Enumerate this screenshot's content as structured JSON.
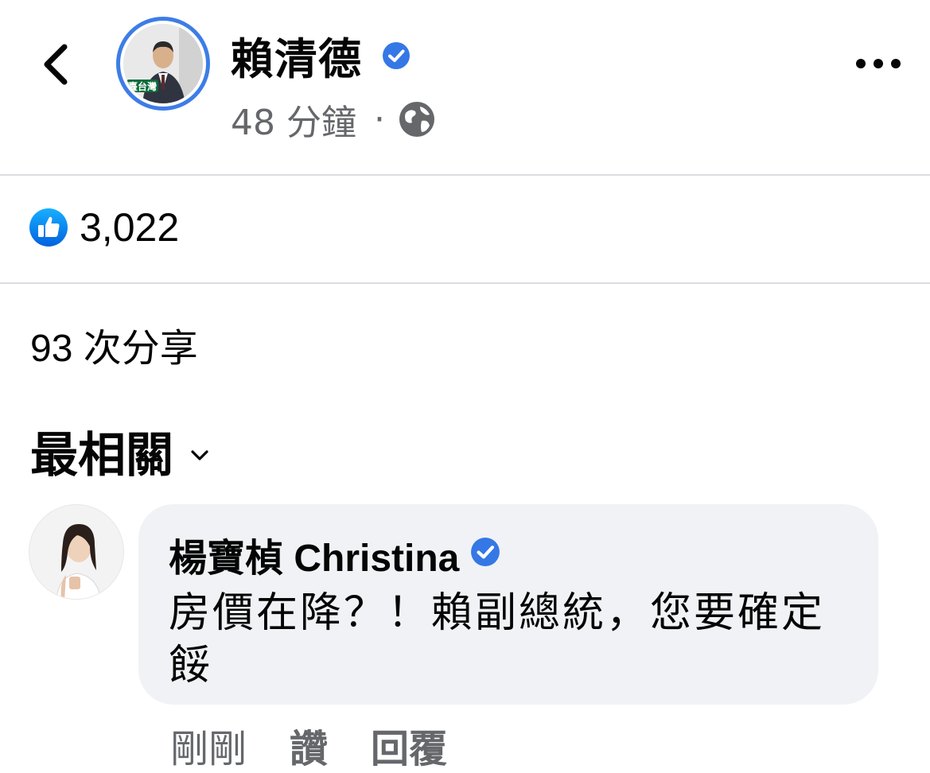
{
  "post": {
    "author": "賴清德",
    "time": "48 分鐘",
    "separator": "·",
    "privacy_icon": "globe-icon",
    "avatar_text": "臺台灣"
  },
  "reactions": {
    "icon": "like-icon",
    "count": "3,022"
  },
  "shares": "93 次分享",
  "sort": {
    "label": "最相關"
  },
  "comment": {
    "author": "楊寶楨 Christina",
    "text": "房價在降？！賴副總統，您要確定餒",
    "time": "剛剛",
    "like_label": "讚",
    "reply_label": "回覆"
  },
  "colors": {
    "verified": "#3578e5",
    "meta_gray": "#65676b",
    "bubble_bg": "#f0f2f5"
  }
}
